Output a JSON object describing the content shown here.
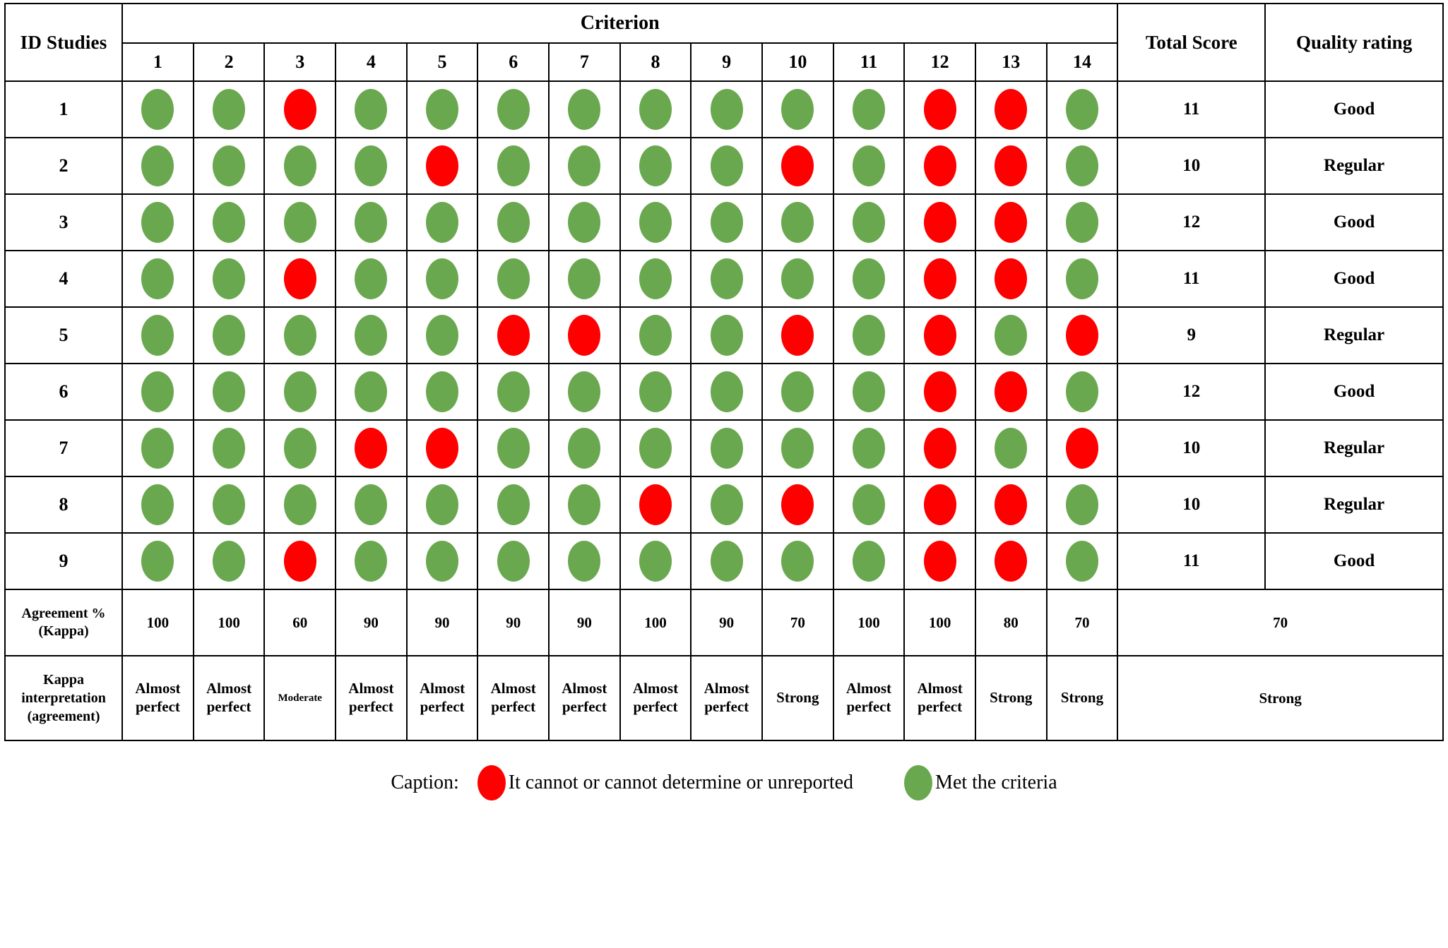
{
  "table": {
    "header": {
      "id_studies": "ID Studies",
      "criterion": "Criterion",
      "total_score": "Total Score",
      "quality_rating": "Quality rating",
      "criteria_numbers": [
        "1",
        "2",
        "3",
        "4",
        "5",
        "6",
        "7",
        "8",
        "9",
        "10",
        "11",
        "12",
        "13",
        "14"
      ]
    },
    "rows": [
      {
        "id": "1",
        "marks": [
          "green",
          "green",
          "red",
          "green",
          "green",
          "green",
          "green",
          "green",
          "green",
          "green",
          "green",
          "red",
          "red",
          "green"
        ],
        "total_score": "11",
        "quality": "Good"
      },
      {
        "id": "2",
        "marks": [
          "green",
          "green",
          "green",
          "green",
          "red",
          "green",
          "green",
          "green",
          "green",
          "red",
          "green",
          "red",
          "red",
          "green"
        ],
        "total_score": "10",
        "quality": "Regular"
      },
      {
        "id": "3",
        "marks": [
          "green",
          "green",
          "green",
          "green",
          "green",
          "green",
          "green",
          "green",
          "green",
          "green",
          "green",
          "red",
          "red",
          "green"
        ],
        "total_score": "12",
        "quality": "Good"
      },
      {
        "id": "4",
        "marks": [
          "green",
          "green",
          "red",
          "green",
          "green",
          "green",
          "green",
          "green",
          "green",
          "green",
          "green",
          "red",
          "red",
          "green"
        ],
        "total_score": "11",
        "quality": "Good"
      },
      {
        "id": "5",
        "marks": [
          "green",
          "green",
          "green",
          "green",
          "green",
          "red",
          "red",
          "green",
          "green",
          "red",
          "green",
          "red",
          "green",
          "red"
        ],
        "total_score": "9",
        "quality": "Regular"
      },
      {
        "id": "6",
        "marks": [
          "green",
          "green",
          "green",
          "green",
          "green",
          "green",
          "green",
          "green",
          "green",
          "green",
          "green",
          "red",
          "red",
          "green"
        ],
        "total_score": "12",
        "quality": "Good"
      },
      {
        "id": "7",
        "marks": [
          "green",
          "green",
          "green",
          "red",
          "red",
          "green",
          "green",
          "green",
          "green",
          "green",
          "green",
          "red",
          "green",
          "red"
        ],
        "total_score": "10",
        "quality": "Regular"
      },
      {
        "id": "8",
        "marks": [
          "green",
          "green",
          "green",
          "green",
          "green",
          "green",
          "green",
          "red",
          "green",
          "red",
          "green",
          "red",
          "red",
          "green"
        ],
        "total_score": "10",
        "quality": "Regular"
      },
      {
        "id": "9",
        "marks": [
          "green",
          "green",
          "red",
          "green",
          "green",
          "green",
          "green",
          "green",
          "green",
          "green",
          "green",
          "red",
          "red",
          "green"
        ],
        "total_score": "11",
        "quality": "Good"
      }
    ],
    "agreement_row": {
      "label_line1": "Agreement %",
      "label_line2": "(Kappa)",
      "values": [
        "100",
        "100",
        "60",
        "90",
        "90",
        "90",
        "90",
        "100",
        "90",
        "70",
        "100",
        "100",
        "80",
        "70"
      ],
      "merged_value": "70"
    },
    "kappa_row": {
      "label_line1": "Kappa",
      "label_line2": "interpretation",
      "label_line3": "(agreement)",
      "values": [
        "Almost perfect",
        "Almost perfect",
        "Moderate",
        "Almost perfect",
        "Almost perfect",
        "Almost perfect",
        "Almost perfect",
        "Almost perfect",
        "Almost perfect",
        "Strong",
        "Almost perfect",
        "Almost perfect",
        "Strong",
        "Strong"
      ],
      "merged_value": "Strong"
    }
  },
  "caption": {
    "label": "Caption:",
    "red_text": "It cannot or cannot determine or unreported",
    "green_text": "Met the criteria"
  },
  "colors": {
    "green": "#6aa84f",
    "red": "#fe0000",
    "border": "#000000",
    "background": "#ffffff"
  }
}
